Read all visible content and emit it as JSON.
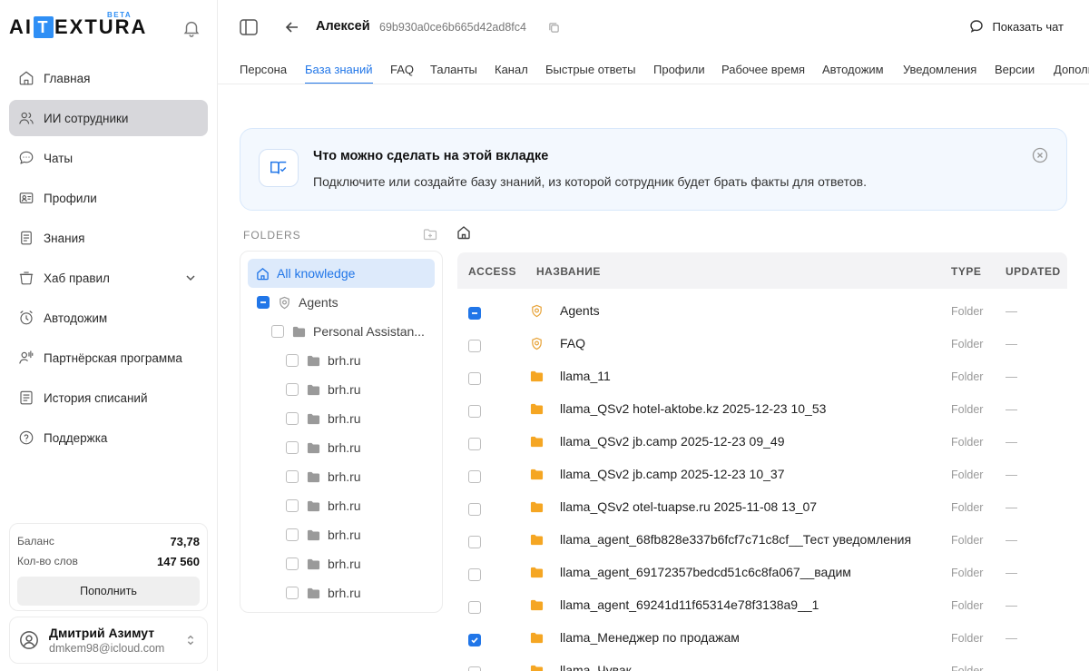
{
  "brand": {
    "logo_text_left": "AI",
    "logo_text_box": "T",
    "logo_text_right": "EXTURA",
    "beta": "BETA"
  },
  "sidebar": {
    "items": [
      {
        "label": "Главная",
        "icon": "home-icon"
      },
      {
        "label": "ИИ сотрудники",
        "icon": "users-icon",
        "active": true
      },
      {
        "label": "Чаты",
        "icon": "chat-icon"
      },
      {
        "label": "Профили",
        "icon": "profile-card-icon"
      },
      {
        "label": "Знания",
        "icon": "document-icon"
      },
      {
        "label": "Хаб правил",
        "icon": "rules-icon",
        "expandable": true
      },
      {
        "label": "Автодожим",
        "icon": "alarm-clock-icon"
      },
      {
        "label": "Партнёрская программа",
        "icon": "partner-icon"
      },
      {
        "label": "История списаний",
        "icon": "history-icon"
      },
      {
        "label": "Поддержка",
        "icon": "help-icon"
      }
    ],
    "balance": {
      "balance_label": "Баланс",
      "balance_value": "73,78",
      "words_label": "Кол-во слов",
      "words_value": "147 560",
      "topup_label": "Пополнить"
    },
    "user": {
      "name": "Дмитрий Азимут",
      "email": "dmkem98@icloud.com"
    }
  },
  "header": {
    "agent_name": "Алексей",
    "agent_id": "69b930a0ce6b665d42ad8fc4",
    "chat_button": "Показать чат"
  },
  "tabs": [
    {
      "label": "Персона"
    },
    {
      "label": "База знаний",
      "active": true
    },
    {
      "label": "FAQ"
    },
    {
      "label": "Таланты"
    },
    {
      "label": "Канал"
    },
    {
      "label": "Быстрые ответы"
    },
    {
      "label": "Профили"
    },
    {
      "label": "Рабочее время"
    },
    {
      "label": "Автодожим"
    },
    {
      "label": "Уведомления"
    },
    {
      "label": "Версии"
    },
    {
      "label": "Дополнительно"
    }
  ],
  "banner": {
    "title": "Что можно сделать на этой вкладке",
    "text": "Подключите или создайте базу знаний, из которой сотрудник будет брать факты для ответов."
  },
  "folders": {
    "label": "FOLDERS",
    "all_knowledge": "All knowledge",
    "agents": "Agents",
    "personal": "Personal Assistan...",
    "children": [
      "brh.ru",
      "brh.ru",
      "brh.ru",
      "brh.ru",
      "brh.ru",
      "brh.ru",
      "brh.ru",
      "brh.ru",
      "brh.ru"
    ]
  },
  "table": {
    "headers": {
      "access": "ACCESS",
      "name": "НАЗВАНИЕ",
      "type": "TYPE",
      "updated": "UPDATED"
    },
    "rows": [
      {
        "name": "Agents",
        "type": "Folder",
        "updated": "—",
        "icon": "shield-folder-icon",
        "check": "partial"
      },
      {
        "name": "FAQ",
        "type": "Folder",
        "updated": "—",
        "icon": "shield-folder-icon",
        "check": "none"
      },
      {
        "name": "llama_11",
        "type": "Folder",
        "updated": "—",
        "icon": "folder-icon",
        "check": "none"
      },
      {
        "name": "llama_QSv2 hotel-aktobe.kz 2025-12-23 10_53",
        "type": "Folder",
        "updated": "—",
        "icon": "folder-icon",
        "check": "none"
      },
      {
        "name": "llama_QSv2 jb.camp 2025-12-23 09_49",
        "type": "Folder",
        "updated": "—",
        "icon": "folder-icon",
        "check": "none"
      },
      {
        "name": "llama_QSv2 jb.camp 2025-12-23 10_37",
        "type": "Folder",
        "updated": "—",
        "icon": "folder-icon",
        "check": "none"
      },
      {
        "name": "llama_QSv2 otel-tuapse.ru 2025-11-08 13_07",
        "type": "Folder",
        "updated": "—",
        "icon": "folder-icon",
        "check": "none"
      },
      {
        "name": "llama_agent_68fb828e337b6fcf7c71c8cf__Тест уведомления",
        "type": "Folder",
        "updated": "—",
        "icon": "folder-icon",
        "check": "none"
      },
      {
        "name": "llama_agent_69172357bedcd51c6c8fa067__вадим",
        "type": "Folder",
        "updated": "—",
        "icon": "folder-icon",
        "check": "none"
      },
      {
        "name": "llama_agent_69241d11f65314e78f3138a9__1",
        "type": "Folder",
        "updated": "—",
        "icon": "folder-icon",
        "check": "none"
      },
      {
        "name": "llama_Менеджер по продажам",
        "type": "Folder",
        "updated": "—",
        "icon": "folder-icon",
        "check": "checked"
      },
      {
        "name": "llama_Чувак",
        "type": "Folder",
        "updated": "—",
        "icon": "folder-icon",
        "check": "none"
      }
    ]
  },
  "colors": {
    "accent": "#2176e8",
    "folder": "#f5a623",
    "active_nav": "#d7d7db",
    "banner_bg": "#f3f8fe"
  }
}
